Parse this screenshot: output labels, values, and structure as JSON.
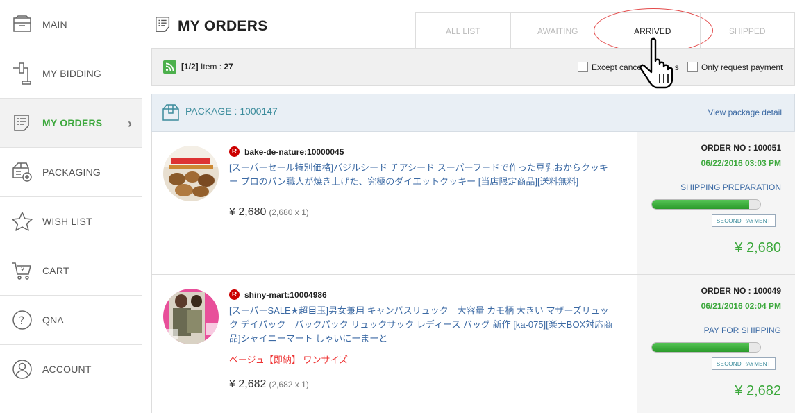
{
  "sidebar": {
    "items": [
      {
        "label": "MAIN",
        "icon": "inbox-icon"
      },
      {
        "label": "MY BIDDING",
        "icon": "gavel-icon"
      },
      {
        "label": "MY ORDERS",
        "icon": "order-list-icon",
        "active": true
      },
      {
        "label": "PACKAGING",
        "icon": "package-add-icon"
      },
      {
        "label": "WISH LIST",
        "icon": "star-icon"
      },
      {
        "label": "CART",
        "icon": "cart-icon"
      },
      {
        "label": "QNA",
        "icon": "question-icon"
      },
      {
        "label": "ACCOUNT",
        "icon": "user-icon"
      }
    ],
    "active_chevron": "›"
  },
  "header": {
    "title": "MY ORDERS",
    "tabs": [
      "ALL LIST",
      "AWAITING",
      "ARRIVED",
      "SHIPPED"
    ],
    "active_tab": "ARRIVED"
  },
  "filter": {
    "page": "[1/2]",
    "item_label": "Item :",
    "item_count": "27",
    "except_cancel": "Except cancel",
    "except_suffix": "s",
    "only_request": "Only request payment"
  },
  "package": {
    "title": "PACKAGE : 1000147",
    "detail_link": "View package detail"
  },
  "orders": [
    {
      "shop": "bake-de-nature:10000045",
      "title": "[スーパーセール特別価格]バジルシード チアシード スーパーフードで作った豆乳おからクッキー プロのパン職人が焼き上げた、究極のダイエットクッキー [当店限定商品][送料無料]",
      "variant": "",
      "price": "¥ 2,680",
      "price_detail": "(2,680 x 1)",
      "order_no": "ORDER NO : 100051",
      "date": "06/22/2016 03:03 PM",
      "status": "SHIPPING PREPARATION",
      "progress": 0.9,
      "button": "SECOND PAYMENT",
      "total": "¥ 2,680"
    },
    {
      "shop": "shiny-mart:10004986",
      "title": "[スーパーSALE★超目玉]男女兼用 キャンバスリュック　大容量 カモ柄 大きい マザーズリュック デイパック　バックパック リュックサック レディース バッグ 新作 [ka-075][楽天BOX対応商品]シャイニーマート しゃいにーまーと",
      "variant": "ベージュ【即納】 ワンサイズ",
      "price": "¥ 2,682",
      "price_detail": "(2,682 x 1)",
      "order_no": "ORDER NO : 100049",
      "date": "06/21/2016 02:04 PM",
      "status": "PAY FOR SHIPPING",
      "progress": 0.9,
      "button": "SECOND PAYMENT",
      "total": "¥ 2,682"
    }
  ],
  "colors": {
    "accent_green": "#3ca83c",
    "link_blue": "#3c6aa4",
    "highlight_red": "#e34a4a"
  }
}
